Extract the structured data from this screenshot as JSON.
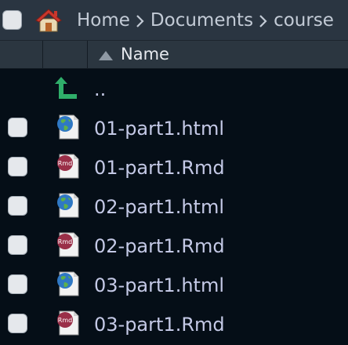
{
  "breadcrumb": {
    "items": [
      "Home",
      "Documents",
      "course"
    ]
  },
  "header": {
    "name_label": "Name",
    "sort_icon": "sort-ascending-icon"
  },
  "files": [
    {
      "name": "..",
      "icon": "parent-folder-icon"
    },
    {
      "name": "01-part1.html",
      "icon": "html-file-icon"
    },
    {
      "name": "01-part1.Rmd",
      "icon": "rmd-file-icon"
    },
    {
      "name": "02-part1.html",
      "icon": "html-file-icon"
    },
    {
      "name": "02-part1.Rmd",
      "icon": "rmd-file-icon"
    },
    {
      "name": "03-part1.html",
      "icon": "html-file-icon"
    },
    {
      "name": "03-part1.Rmd",
      "icon": "rmd-file-icon"
    }
  ],
  "colors": {
    "background": "#050e17",
    "toolbar": "#2a3541",
    "text": "#c4c9e6",
    "rmd_badge": "#9a2f48",
    "parent_arrow": "#2fae6a",
    "home_roof": "#c9372c"
  }
}
